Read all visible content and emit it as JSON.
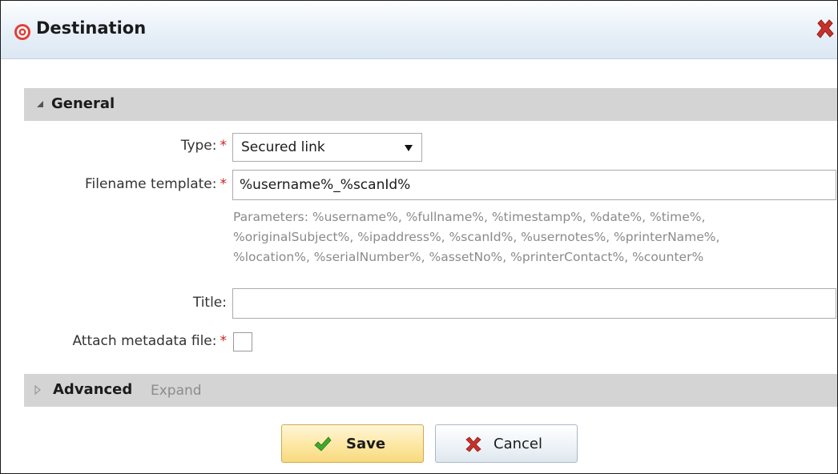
{
  "dialog": {
    "title": "Destination",
    "title_icon": "target-icon",
    "close_icon": "close-icon"
  },
  "sections": {
    "general": {
      "label": "General",
      "state": "expanded"
    },
    "advanced": {
      "label": "Advanced",
      "expand_label": "Expand",
      "state": "collapsed"
    }
  },
  "form": {
    "type": {
      "label": "Type:",
      "required": "*",
      "value": "Secured link"
    },
    "filename_template": {
      "label": "Filename template:",
      "required": "*",
      "value": "%username%_%scanId%",
      "hint_lines": [
        "Parameters: %username%, %fullname%, %timestamp%, %date%, %time%,",
        "%originalSubject%, %ipaddress%, %scanId%, %usernotes%, %printerName%,",
        "%location%, %serialNumber%, %assetNo%, %printerContact%, %counter%"
      ]
    },
    "title": {
      "label": "Title:",
      "value": ""
    },
    "attach_metadata": {
      "label": "Attach metadata file:",
      "required": "*",
      "checked": false
    }
  },
  "buttons": {
    "save": {
      "label": "Save",
      "icon": "checkmark-icon"
    },
    "cancel": {
      "label": "Cancel",
      "icon": "x-icon"
    }
  },
  "colors": {
    "required": "#cc2222",
    "section_bar": "#d4d4d4",
    "save_button": "#fde7a3",
    "close_x": "#c8312b",
    "title_icon": "#e0403a"
  }
}
